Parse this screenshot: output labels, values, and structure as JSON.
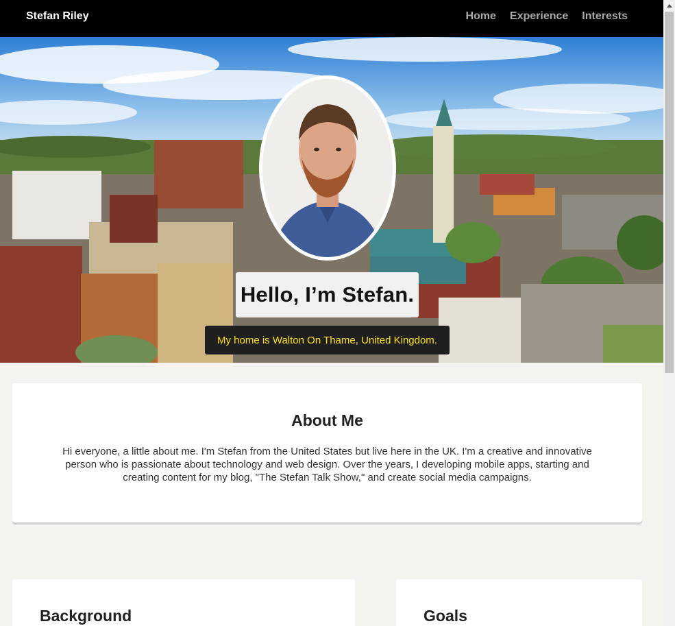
{
  "navbar": {
    "brand": "Stefan Riley",
    "links": [
      {
        "label": "Home"
      },
      {
        "label": "Experience"
      },
      {
        "label": "Interests"
      }
    ]
  },
  "hero": {
    "greeting": "Hello, I’m Stefan.",
    "home": "My home is Walton On Thame, United Kingdom."
  },
  "about": {
    "title": "About Me",
    "text": "Hi everyone, a little about me. I'm Stefan from the United States but live here in the UK. I'm a creative and innovative person who is passionate about technology and web design. Over the years, I developing mobile apps, starting and creating content for my blog, \"The Stefan Talk Show,\" and create social media campaigns."
  },
  "cards": [
    {
      "title": "Background"
    },
    {
      "title": "Goals"
    }
  ],
  "colors": {
    "navbar_bg": "#000000",
    "nav_link": "#a8a8a8",
    "home_text": "#ffe600",
    "page_bg": "#f4f3f0"
  }
}
